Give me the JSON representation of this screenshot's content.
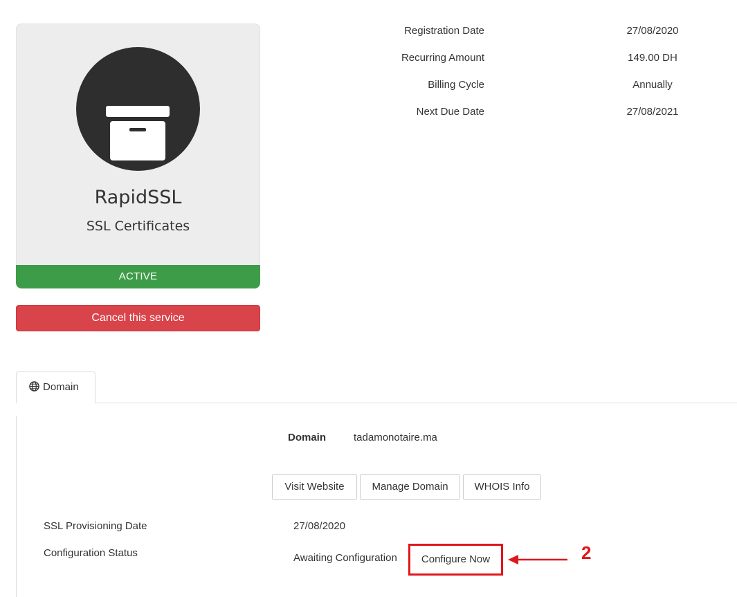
{
  "product": {
    "icon": "archive-box-icon",
    "name": "RapidSSL",
    "group": "SSL Certificates",
    "status": "Active",
    "status_color": "#3d9c47"
  },
  "actions": {
    "cancel_label": "Cancel this service",
    "cancel_color": "#d9434a"
  },
  "billing": [
    {
      "label": "Registration Date",
      "value": "27/08/2020"
    },
    {
      "label": "Recurring Amount",
      "value": "149.00 DH"
    },
    {
      "label": "Billing Cycle",
      "value": "Annually"
    },
    {
      "label": "Next Due Date",
      "value": "27/08/2021"
    }
  ],
  "tabs": [
    {
      "label": "Domain",
      "icon": "globe-icon",
      "active": true
    }
  ],
  "domain": {
    "label": "Domain",
    "value": "tadamonotaire.ma",
    "buttons": {
      "visit": "Visit Website",
      "manage": "Manage Domain",
      "whois": "WHOIS Info"
    }
  },
  "ssl": {
    "provisioning_label": "SSL Provisioning Date",
    "provisioning_value": "27/08/2020",
    "config_label": "Configuration Status",
    "config_value": "Awaiting Configuration",
    "configure_label": "Configure Now"
  },
  "annotation": {
    "number": "2",
    "color": "#e3151c"
  }
}
